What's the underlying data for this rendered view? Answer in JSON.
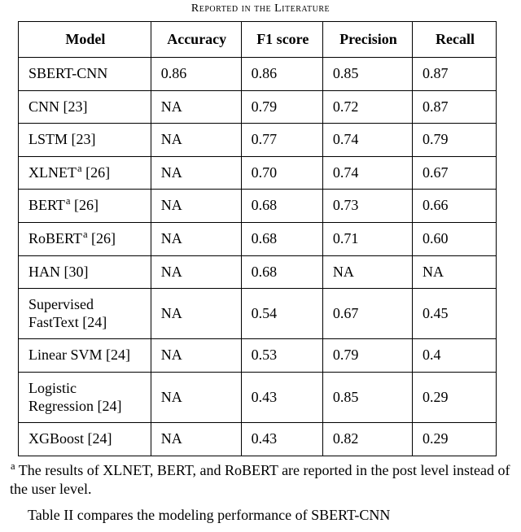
{
  "caption_top_fragment": "Reported in the Literature",
  "headers": {
    "model": "Model",
    "accuracy": "Accuracy",
    "f1": "F1 score",
    "precision": "Precision",
    "recall": "Recall"
  },
  "rows": [
    {
      "model": "SBERT-CNN",
      "sup": "",
      "accuracy": "0.86",
      "f1": "0.86",
      "precision": "0.85",
      "recall": "0.87"
    },
    {
      "model": "CNN [23]",
      "sup": "",
      "accuracy": "NA",
      "f1": "0.79",
      "precision": "0.72",
      "recall": "0.87"
    },
    {
      "model": "LSTM [23]",
      "sup": "",
      "accuracy": "NA",
      "f1": "0.77",
      "precision": "0.74",
      "recall": "0.79"
    },
    {
      "model": "XLNET",
      "sup": "a",
      "cite": " [26]",
      "accuracy": "NA",
      "f1": "0.70",
      "precision": "0.74",
      "recall": "0.67"
    },
    {
      "model": "BERT",
      "sup": "a",
      "cite": " [26]",
      "accuracy": "NA",
      "f1": "0.68",
      "precision": "0.73",
      "recall": "0.66"
    },
    {
      "model": "RoBERT",
      "sup": "a",
      "cite": " [26]",
      "accuracy": "NA",
      "f1": "0.68",
      "precision": "0.71",
      "recall": "0.60"
    },
    {
      "model": "HAN [30]",
      "sup": "",
      "accuracy": "NA",
      "f1": "0.68",
      "precision": "NA",
      "recall": "NA"
    },
    {
      "model": "Supervised FastText [24]",
      "sup": "",
      "accuracy": "NA",
      "f1": "0.54",
      "precision": "0.67",
      "recall": "0.45"
    },
    {
      "model": "Linear SVM [24]",
      "sup": "",
      "accuracy": "NA",
      "f1": "0.53",
      "precision": "0.79",
      "recall": "0.4"
    },
    {
      "model": "Logistic Regression [24]",
      "sup": "",
      "accuracy": "NA",
      "f1": "0.43",
      "precision": "0.85",
      "recall": "0.29"
    },
    {
      "model": "XGBoost [24]",
      "sup": "",
      "accuracy": "NA",
      "f1": "0.43",
      "precision": "0.82",
      "recall": "0.29"
    }
  ],
  "footnote": {
    "marker": "a",
    "text": " The results of XLNET, BERT, and RoBERT are reported in the post level instead of the user level."
  },
  "caption_bottom_partial": "Table II compares the modeling performance of SBERT-CNN",
  "chart_data": {
    "type": "table",
    "title": "Reported in the Literature",
    "columns": [
      "Model",
      "Accuracy",
      "F1 score",
      "Precision",
      "Recall"
    ],
    "rows": [
      [
        "SBERT-CNN",
        0.86,
        0.86,
        0.85,
        0.87
      ],
      [
        "CNN [23]",
        null,
        0.79,
        0.72,
        0.87
      ],
      [
        "LSTM [23]",
        null,
        0.77,
        0.74,
        0.79
      ],
      [
        "XLNET [26]",
        null,
        0.7,
        0.74,
        0.67
      ],
      [
        "BERT [26]",
        null,
        0.68,
        0.73,
        0.66
      ],
      [
        "RoBERT [26]",
        null,
        0.68,
        0.71,
        0.6
      ],
      [
        "HAN [30]",
        null,
        0.68,
        null,
        null
      ],
      [
        "Supervised FastText [24]",
        null,
        0.54,
        0.67,
        0.45
      ],
      [
        "Linear SVM [24]",
        null,
        0.53,
        0.79,
        0.4
      ],
      [
        "Logistic Regression [24]",
        null,
        0.43,
        0.85,
        0.29
      ],
      [
        "XGBoost [24]",
        null,
        0.43,
        0.82,
        0.29
      ]
    ],
    "notes": "Superscript a on XLNET, BERT, RoBERT indicates results reported at the post level instead of the user level."
  }
}
